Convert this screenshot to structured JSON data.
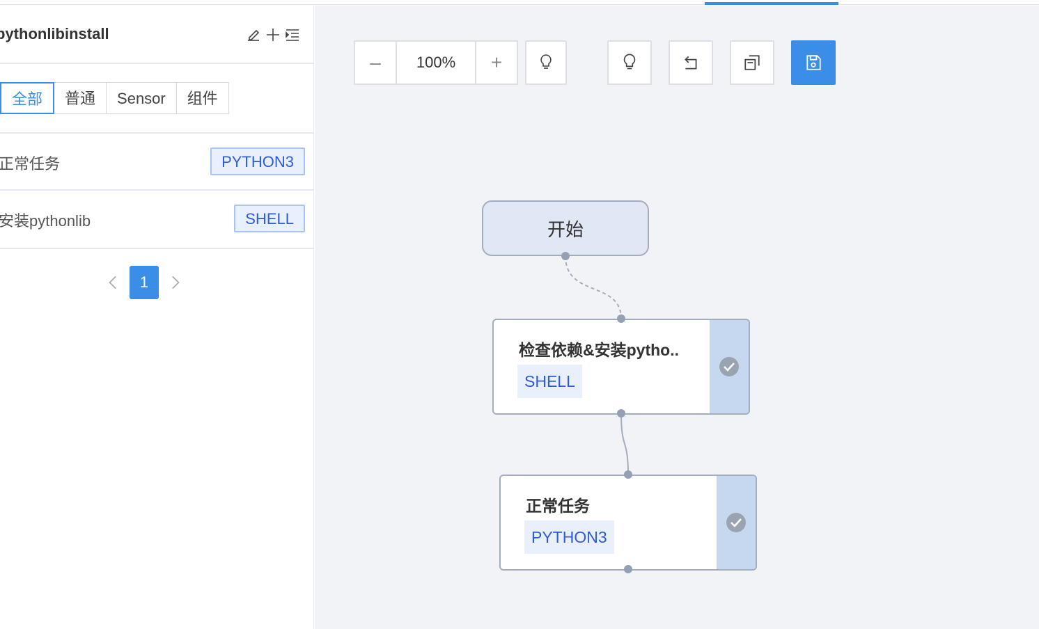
{
  "sidebar": {
    "title": "pythonlibinstall",
    "tabs": [
      "全部",
      "普通",
      "Sensor",
      "组件"
    ],
    "tasks": [
      {
        "name": "正常任务",
        "tag": "PYTHON3"
      },
      {
        "name": "安装pythonlib",
        "tag": "SHELL"
      }
    ],
    "pagination": {
      "current": "1"
    }
  },
  "toolbar": {
    "zoom_minus": "–",
    "zoom_value": "100%",
    "zoom_plus": "+"
  },
  "flow": {
    "start": {
      "label": "开始"
    },
    "nodes": [
      {
        "title": "检查依赖&安装pytho..",
        "tag": "SHELL"
      },
      {
        "title": "正常任务",
        "tag": "PYTHON3"
      }
    ]
  },
  "colors": {
    "accent": "#3a8ee6",
    "tag_text": "#2f5bd5",
    "canvas_bg": "#f2f3f7"
  }
}
